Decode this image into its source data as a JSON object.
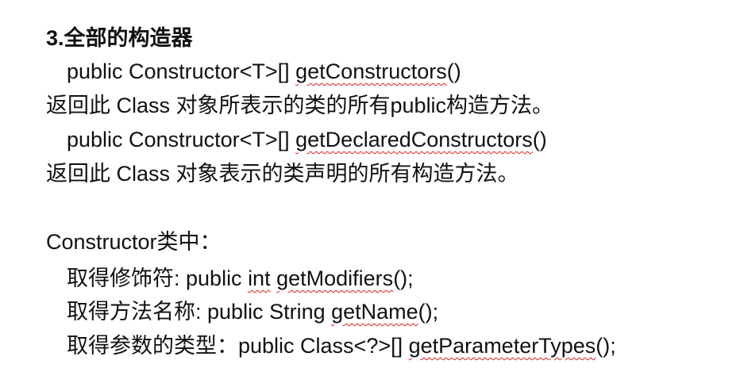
{
  "section": {
    "heading": "3.全部的构造器"
  },
  "methods": [
    {
      "signature_prefix": "public Constructor<T>[] ",
      "method_name": "getConstructors",
      "signature_suffix": "()",
      "description": "返回此 Class 对象所表示的类的所有public构造方法。"
    },
    {
      "signature_prefix": "public Constructor<T>[] ",
      "method_name": "getDeclaredConstructors",
      "signature_suffix": "()",
      "description": "返回此 Class 对象表示的类声明的所有构造方法。"
    }
  ],
  "constructor_class": {
    "heading": "Constructor类中：",
    "items": [
      {
        "label": "取得修饰符: ",
        "code_prefix": "public ",
        "type_word": "int",
        "space": " ",
        "method_name": "getModifiers",
        "code_suffix": "();"
      },
      {
        "label": "取得方法名称: ",
        "code_prefix": "public String ",
        "method_name": "getName",
        "code_suffix": "();"
      },
      {
        "label": "取得参数的类型：",
        "code_prefix": "public Class<?>[] ",
        "method_name": "getParameterTypes",
        "code_suffix": "();"
      }
    ]
  },
  "colors": {
    "text": "#111111",
    "spellcheck_underline": "#e0201b",
    "background": "#ffffff"
  }
}
